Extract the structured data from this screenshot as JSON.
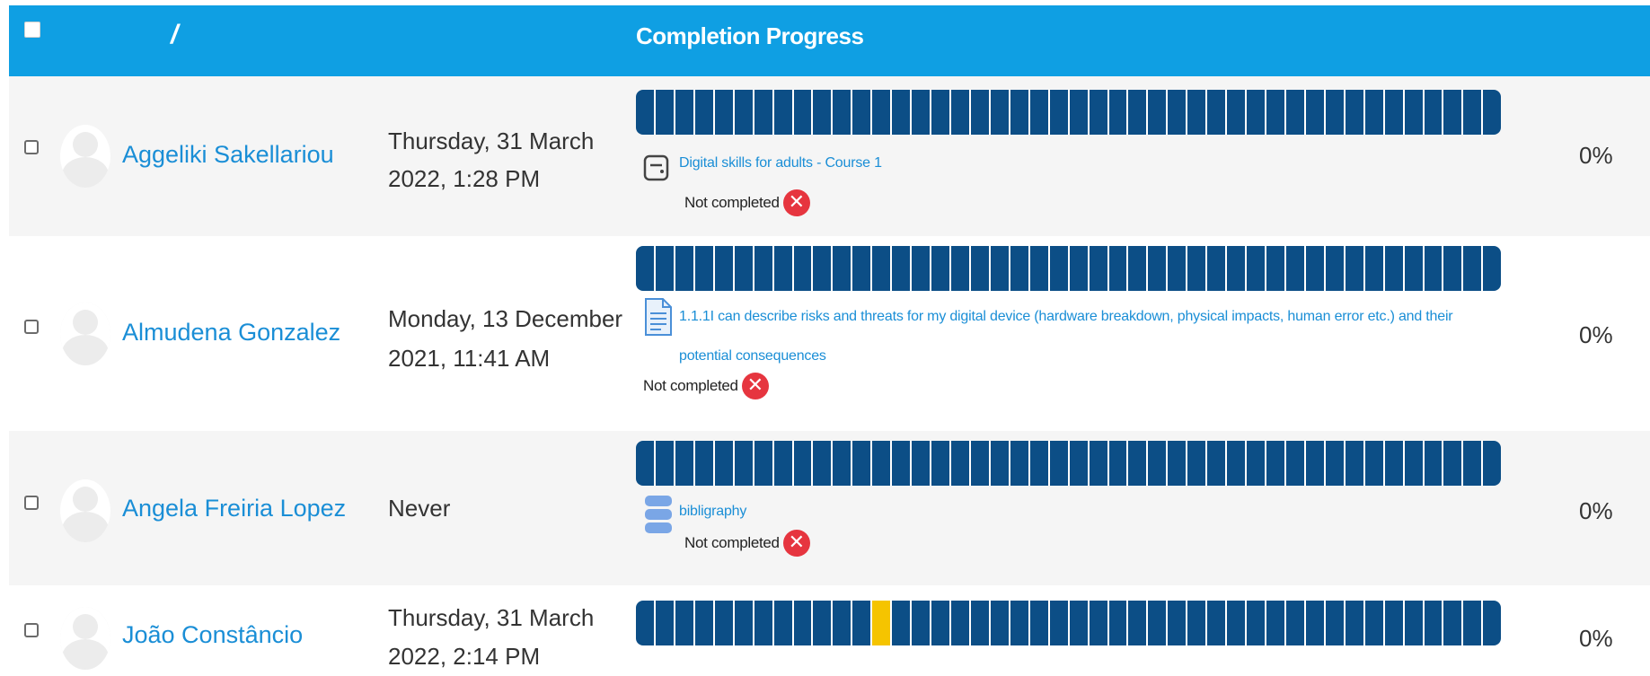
{
  "header": {
    "slash": "/",
    "completion_title": "Completion Progress"
  },
  "rows": [
    {
      "name": "Aggeliki Sakellariou",
      "date_line1": "Thursday, 31 March",
      "date_line2": "2022, 1:28 PM",
      "activity_icon": "assignment-icon",
      "activity": "Digital skills for adults - Course 1",
      "activity_line2": "",
      "status": "Not completed",
      "percent": "0%"
    },
    {
      "name": "Almudena Gonzalez",
      "date_line1": "Monday, 13 December",
      "date_line2": "2021, 11:41 AM",
      "activity_icon": "document-icon",
      "activity": "1.1.1I can describe risks and threats for my digital device (hardware breakdown, physical impacts, human error etc.) and their",
      "activity_line2": "potential consequences",
      "status": "Not completed",
      "percent": "0%"
    },
    {
      "name": "Angela Freiria Lopez",
      "date_line1": "Never",
      "date_line2": "",
      "activity_icon": "database-icon",
      "activity": "bibligraphy",
      "activity_line2": "",
      "status": "Not completed",
      "percent": "0%"
    },
    {
      "name": "João Constâncio",
      "date_line1": "Thursday, 31 March",
      "date_line2": "2022, 2:14 PM",
      "activity_icon": "",
      "activity": "",
      "activity_line2": "",
      "status": "",
      "percent": "0%"
    }
  ],
  "progress_bar": {
    "segments": 44,
    "current_segment_row4": 12,
    "color_incomplete": "#0c4e86",
    "color_current": "#f5c400"
  },
  "colors": {
    "header_bg": "#0f9fe3",
    "link": "#1a8ed6",
    "not_completed": "#e6353f"
  }
}
